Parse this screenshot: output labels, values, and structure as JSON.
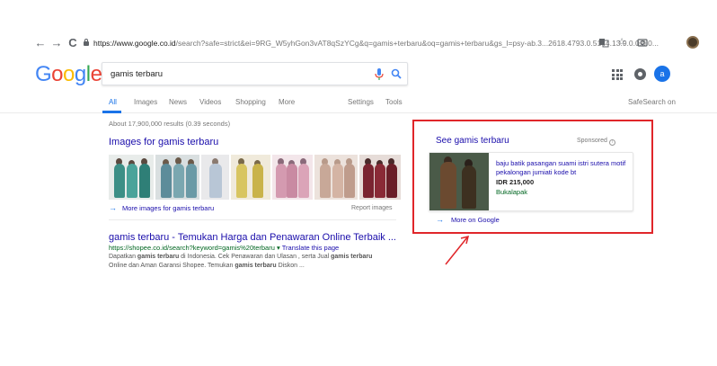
{
  "browser": {
    "back": "←",
    "forward": "→",
    "reload": "C",
    "url_host": "https://www.google.co.id",
    "url_rest": "/search?safe=strict&ei=9RG_W5yhGon3vAT8qSzYCg&q=gamis+terbaru&oq=gamis+terbaru&gs_l=psy-ab.3...2618.4793.0.5144.13.9.0.0.0.0...",
    "star": "☆"
  },
  "header": {
    "logo": [
      "G",
      "o",
      "o",
      "g",
      "l",
      "e"
    ],
    "logo_colors": [
      "#4285F4",
      "#EA4335",
      "#FBBC05",
      "#4285F4",
      "#34A853",
      "#EA4335"
    ],
    "search_value": "gamis terbaru",
    "avatar_letter": "a"
  },
  "tabs": {
    "items": [
      "All",
      "Images",
      "News",
      "Videos",
      "Shopping",
      "More"
    ],
    "settings": "Settings",
    "tools": "Tools",
    "safesearch": "SafeSearch on"
  },
  "results": {
    "stats": "About 17,900,000 results (0.39 seconds)",
    "images_title": "Images for gamis terbaru",
    "more_images": "More images for gamis terbaru",
    "report_images": "Report images",
    "organic": {
      "title": "gamis terbaru - Temukan Harga dan Penawaran Online Terbaik ...",
      "url": "https://shopee.co.id/search?keyword=gamis%20terbaru",
      "translate": "Translate this page",
      "snippet_parts": [
        {
          "t": "Dapatkan ",
          "b": false
        },
        {
          "t": "gamis terbaru",
          "b": true
        },
        {
          "t": " di Indonesia. Cek Penawaran dan Ulasan , serta Jual ",
          "b": false
        },
        {
          "t": "gamis terbaru",
          "b": true
        },
        {
          "t": " Online dan Aman Garansi Shopee. Temukan ",
          "b": false
        },
        {
          "t": "gamis terbaru",
          "b": true
        },
        {
          "t": " Diskon ...",
          "b": false
        }
      ]
    }
  },
  "ad": {
    "title": "See gamis terbaru",
    "sponsored": "Sponsored",
    "product_name": "baju batik pasangan suami istri sutera motif pekalongan jumiati kode bt",
    "price": "IDR 215,000",
    "merchant": "Bukalapak",
    "more": "More on Google",
    "highlight_color": "#e0262a"
  }
}
